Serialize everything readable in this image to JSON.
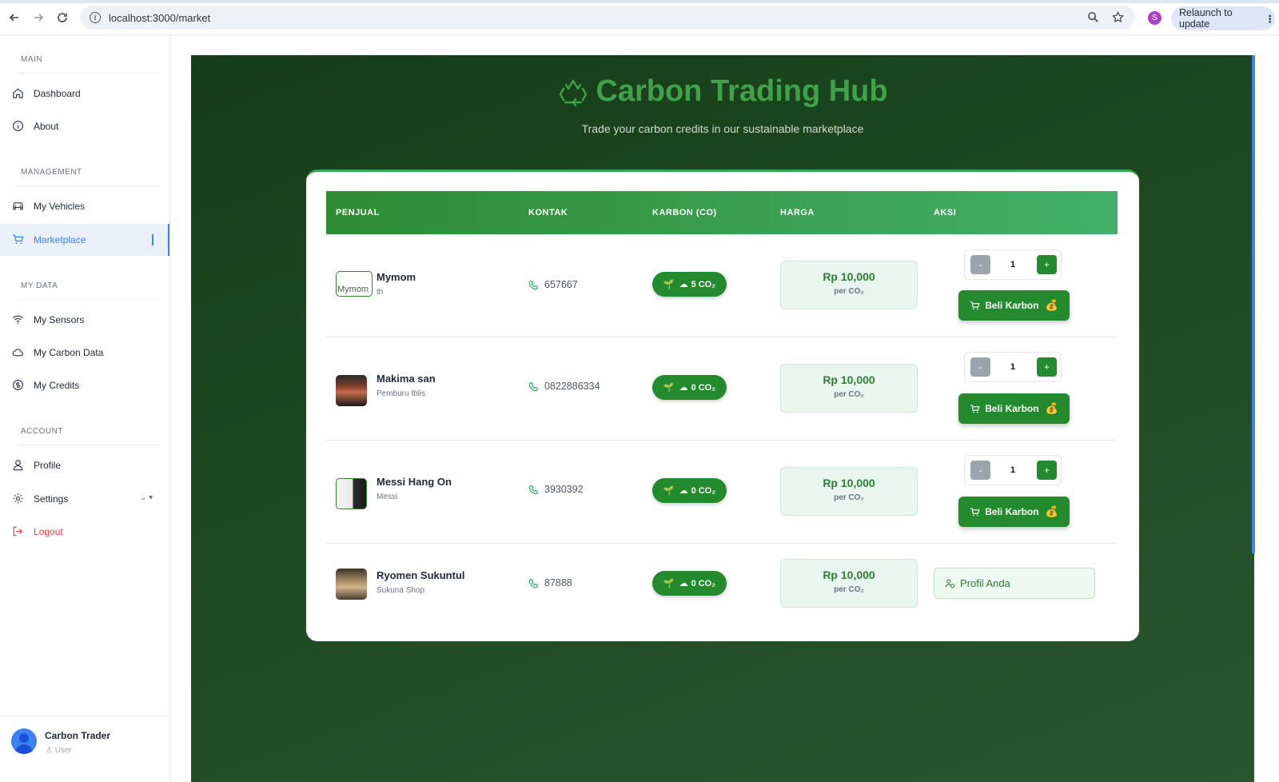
{
  "browser": {
    "url": "localhost:3000/market",
    "profile_initial": "S",
    "relaunch_label": "Relaunch to update"
  },
  "sidebar": {
    "sections": {
      "main": "MAIN",
      "management": "MANAGEMENT",
      "my_data": "MY DATA",
      "account": "ACCOUNT"
    },
    "items": [
      {
        "label": "Dashboard",
        "icon": "home-icon"
      },
      {
        "label": "About",
        "icon": "info-icon"
      },
      {
        "label": "My Vehicles",
        "icon": "car-icon"
      },
      {
        "label": "Marketplace",
        "icon": "cart-icon",
        "active": true
      },
      {
        "label": "My Sensors",
        "icon": "wifi-icon"
      },
      {
        "label": "My Carbon Data",
        "icon": "cloud-icon"
      },
      {
        "label": "My Credits",
        "icon": "coin-icon"
      },
      {
        "label": "Profile",
        "icon": "user-icon"
      },
      {
        "label": "Settings",
        "icon": "gear-icon"
      },
      {
        "label": "Logout",
        "icon": "logout-icon"
      }
    ],
    "user": {
      "name": "Carbon Trader",
      "role": "User"
    }
  },
  "hero": {
    "title": "Carbon Trading Hub",
    "subtitle": "Trade your carbon credits in our sustainable marketplace"
  },
  "table": {
    "headers": [
      "PENJUAL",
      "KONTAK",
      "KARBON (CO)",
      "HARGA",
      "AKSI"
    ],
    "rows": [
      {
        "name": "Mymom",
        "sub": "th",
        "thumb_alt": "Mymom",
        "phone": "657667",
        "co2": "5 CO₂",
        "price": "Rp 10,000",
        "per": "per CO₂",
        "qty": "1",
        "action": "Beli Karbon"
      },
      {
        "name": "Makima san",
        "sub": "Pemburu Iblis",
        "phone": "0822886334",
        "co2": "0 CO₂",
        "price": "Rp 10,000",
        "per": "per CO₂",
        "qty": "1",
        "action": "Beli Karbon"
      },
      {
        "name": "Messi Hang On",
        "sub": "Messi",
        "phone": "3930392",
        "co2": "0 CO₂",
        "price": "Rp 10,000",
        "per": "per CO₂",
        "qty": "1",
        "action": "Beli Karbon"
      },
      {
        "name": "Ryomen Sukuntul",
        "sub": "Sukuna Shop",
        "phone": "87888",
        "co2": "0 CO₂",
        "price": "Rp 10,000",
        "per": "per CO₂",
        "action": "Profil Anda"
      }
    ],
    "minus_label": "-",
    "plus_label": "+"
  },
  "colors": {
    "accent_green": "#238a2e",
    "active_blue": "#3b82f6",
    "logout_red": "#ef4444"
  }
}
